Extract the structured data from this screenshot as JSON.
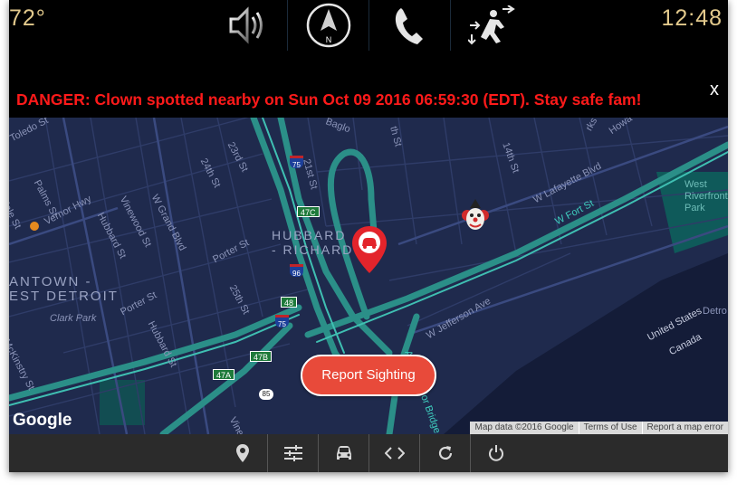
{
  "status": {
    "temperature": "72°",
    "time": "12:48"
  },
  "top_nav": {
    "items": [
      {
        "icon": "speaker-icon"
      },
      {
        "icon": "compass-icon",
        "letter": "N"
      },
      {
        "icon": "phone-icon"
      },
      {
        "icon": "climate-fan-icon"
      }
    ]
  },
  "alert": {
    "message": "DANGER: Clown spotted nearby on Sun Oct 09 2016 06:59:30 (EDT). Stay safe fam!",
    "close": "x",
    "color": "#ff1a1a"
  },
  "map": {
    "areas": [
      {
        "line1": "HUBBARD",
        "line2": "- RICHARD"
      },
      {
        "line1": "ANTOWN -",
        "line2": "EST DETROIT"
      }
    ],
    "streets": [
      "Toledo St",
      "Palms St",
      "Vernor Hwy",
      "dale St",
      "W Grand Blvd",
      "Vinewood St",
      "Hubbard St",
      "24th St",
      "23rd St",
      "21st St",
      "Porter St",
      "25th St",
      "Porter St",
      "Hubbard St",
      "McKinstry St",
      "Clark Park",
      "Vinewood",
      "14th St",
      "th St",
      "W Lafayette Blvd",
      "W Fort St",
      "W Jefferson Ave",
      "United States",
      "Canada",
      "West Riverfront Park",
      "rks Blvd",
      "Howa",
      "Baglo",
      "Ambassador Bridge",
      "Detro"
    ],
    "shields": {
      "interstate": [
        "75",
        "96",
        "75"
      ],
      "exits": [
        "47C",
        "48",
        "47B",
        "47A"
      ],
      "state": [
        "85"
      ]
    },
    "report_button": "Report Sighting",
    "google": "Google",
    "attribution": [
      "Map data ©2016 Google",
      "Terms of Use",
      "Report a map error"
    ]
  },
  "bottom_nav": {
    "items": [
      {
        "icon": "location-pin-icon"
      },
      {
        "icon": "sliders-icon"
      },
      {
        "icon": "car-icon"
      },
      {
        "icon": "code-icon"
      },
      {
        "icon": "refresh-icon"
      },
      {
        "icon": "power-icon"
      }
    ]
  }
}
